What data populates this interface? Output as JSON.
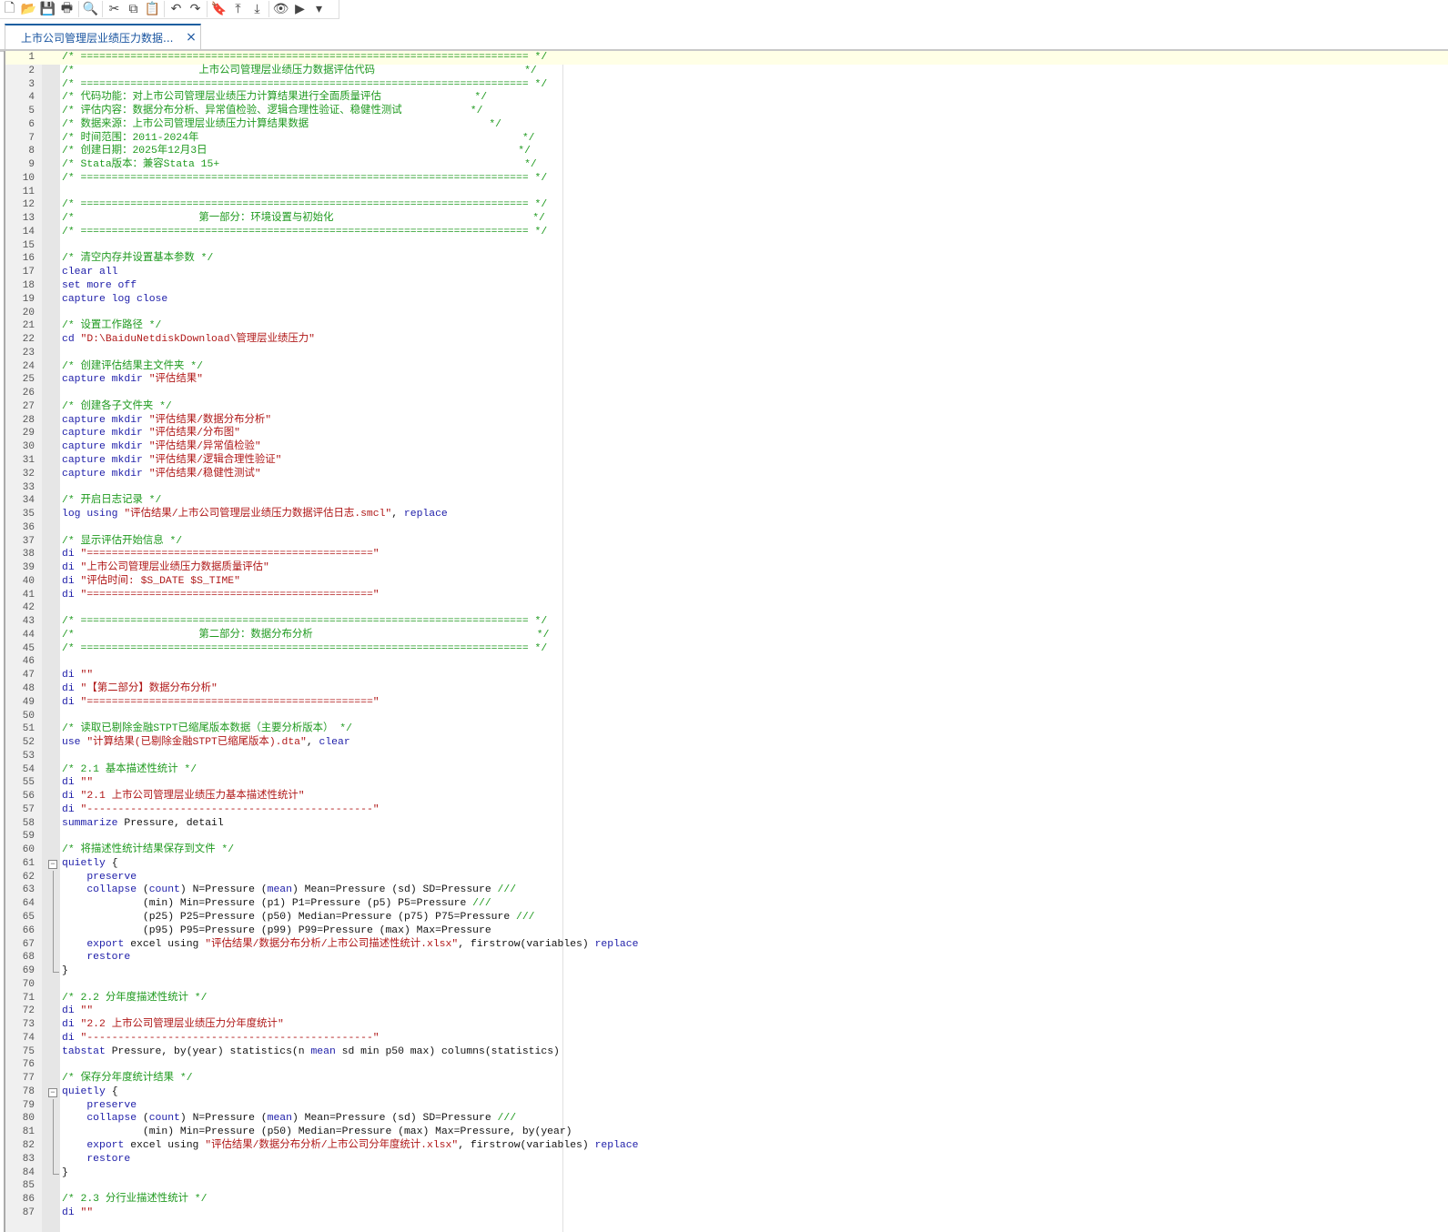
{
  "toolbar": {
    "items": [
      {
        "name": "new-file-icon",
        "glyph": "🗋"
      },
      {
        "name": "open-folder-icon",
        "glyph": "📂"
      },
      {
        "name": "save-icon",
        "glyph": "💾"
      },
      {
        "name": "print-icon",
        "glyph": "🖶"
      },
      {
        "sep": true
      },
      {
        "name": "find-icon",
        "glyph": "🔍"
      },
      {
        "sep": true
      },
      {
        "name": "cut-icon",
        "glyph": "✂"
      },
      {
        "name": "copy-icon",
        "glyph": "⧉"
      },
      {
        "name": "paste-icon",
        "glyph": "📋"
      },
      {
        "sep": true
      },
      {
        "name": "undo-icon",
        "glyph": "↶"
      },
      {
        "name": "redo-icon",
        "glyph": "↷"
      },
      {
        "sep": true
      },
      {
        "name": "toggle-bookmark-icon",
        "glyph": "🔖"
      },
      {
        "name": "previous-bookmark-icon",
        "glyph": "⤒"
      },
      {
        "name": "next-bookmark-icon",
        "glyph": "⤓"
      },
      {
        "sep": true
      },
      {
        "name": "show-file-icon",
        "glyph": "👁"
      },
      {
        "name": "execute-icon",
        "glyph": "▶"
      },
      {
        "name": "execute-dropdown-icon",
        "glyph": "▾"
      }
    ]
  },
  "tab": {
    "label": "上市公司管理层业绩压力数据...",
    "close": "×"
  },
  "colors": {
    "comment": "#1f9a1f",
    "keyword": "#1c1ca8",
    "string": "#b01818",
    "plain": "#111111"
  },
  "code": {
    "lines": [
      [
        [
          "c",
          "/* ======================================================================== */"
        ]
      ],
      [
        [
          "c",
          "/*                    上市公司管理层业绩压力数据评估代码                        */"
        ]
      ],
      [
        [
          "c",
          "/* ======================================================================== */"
        ]
      ],
      [
        [
          "c",
          "/* 代码功能：对上市公司管理层业绩压力计算结果进行全面质量评估               */"
        ]
      ],
      [
        [
          "c",
          "/* 评估内容：数据分布分析、异常值检验、逻辑合理性验证、稳健性测试           */"
        ]
      ],
      [
        [
          "c",
          "/* 数据来源：上市公司管理层业绩压力计算结果数据                             */"
        ]
      ],
      [
        [
          "c",
          "/* 时间范围：2011-2024年                                                    */"
        ]
      ],
      [
        [
          "c",
          "/* 创建日期：2025年12月3日                                                  */"
        ]
      ],
      [
        [
          "c",
          "/* Stata版本：兼容Stata 15+                                                 */"
        ]
      ],
      [
        [
          "c",
          "/* ======================================================================== */"
        ]
      ],
      [],
      [
        [
          "c",
          "/* ======================================================================== */"
        ]
      ],
      [
        [
          "c",
          "/*                    第一部分：环境设置与初始化                                */"
        ]
      ],
      [
        [
          "c",
          "/* ======================================================================== */"
        ]
      ],
      [],
      [
        [
          "c",
          "/* 清空内存并设置基本参数 */"
        ]
      ],
      [
        [
          "k",
          "clear all"
        ]
      ],
      [
        [
          "k",
          "set more off"
        ]
      ],
      [
        [
          "k",
          "capture log close"
        ]
      ],
      [],
      [
        [
          "c",
          "/* 设置工作路径 */"
        ]
      ],
      [
        [
          "k",
          "cd "
        ],
        [
          "s",
          "\"D:\\BaiduNetdiskDownload\\管理层业绩压力\""
        ]
      ],
      [],
      [
        [
          "c",
          "/* 创建评估结果主文件夹 */"
        ]
      ],
      [
        [
          "k",
          "capture mkdir "
        ],
        [
          "s",
          "\"评估结果\""
        ]
      ],
      [],
      [
        [
          "c",
          "/* 创建各子文件夹 */"
        ]
      ],
      [
        [
          "k",
          "capture mkdir "
        ],
        [
          "s",
          "\"评估结果/数据分布分析\""
        ]
      ],
      [
        [
          "k",
          "capture mkdir "
        ],
        [
          "s",
          "\"评估结果/分布图\""
        ]
      ],
      [
        [
          "k",
          "capture mkdir "
        ],
        [
          "s",
          "\"评估结果/异常值检验\""
        ]
      ],
      [
        [
          "k",
          "capture mkdir "
        ],
        [
          "s",
          "\"评估结果/逻辑合理性验证\""
        ]
      ],
      [
        [
          "k",
          "capture mkdir "
        ],
        [
          "s",
          "\"评估结果/稳健性测试\""
        ]
      ],
      [],
      [
        [
          "c",
          "/* 开启日志记录 */"
        ]
      ],
      [
        [
          "k",
          "log using "
        ],
        [
          "s",
          "\"评估结果/上市公司管理层业绩压力数据评估日志.smcl\""
        ],
        [
          "p",
          ", "
        ],
        [
          "k",
          "replace"
        ]
      ],
      [],
      [
        [
          "c",
          "/* 显示评估开始信息 */"
        ]
      ],
      [
        [
          "k",
          "di "
        ],
        [
          "s",
          "\"==============================================\""
        ]
      ],
      [
        [
          "k",
          "di "
        ],
        [
          "s",
          "\"上市公司管理层业绩压力数据质量评估\""
        ]
      ],
      [
        [
          "k",
          "di "
        ],
        [
          "s",
          "\"评估时间: $S_DATE $S_TIME\""
        ]
      ],
      [
        [
          "k",
          "di "
        ],
        [
          "s",
          "\"==============================================\""
        ]
      ],
      [],
      [
        [
          "c",
          "/* ======================================================================== */"
        ]
      ],
      [
        [
          "c",
          "/*                    第二部分：数据分布分析                                    */"
        ]
      ],
      [
        [
          "c",
          "/* ======================================================================== */"
        ]
      ],
      [],
      [
        [
          "k",
          "di "
        ],
        [
          "s",
          "\"\""
        ]
      ],
      [
        [
          "k",
          "di "
        ],
        [
          "s",
          "\"【第二部分】数据分布分析\""
        ]
      ],
      [
        [
          "k",
          "di "
        ],
        [
          "s",
          "\"==============================================\""
        ]
      ],
      [],
      [
        [
          "c",
          "/* 读取已剔除金融STPT已缩尾版本数据（主要分析版本） */"
        ]
      ],
      [
        [
          "k",
          "use "
        ],
        [
          "s",
          "\"计算结果(已剔除金融STPT已缩尾版本).dta\""
        ],
        [
          "p",
          ", "
        ],
        [
          "k",
          "clear"
        ]
      ],
      [],
      [
        [
          "c",
          "/* 2.1 基本描述性统计 */"
        ]
      ],
      [
        [
          "k",
          "di "
        ],
        [
          "s",
          "\"\""
        ]
      ],
      [
        [
          "k",
          "di "
        ],
        [
          "s",
          "\"2.1 上市公司管理层业绩压力基本描述性统计\""
        ]
      ],
      [
        [
          "k",
          "di "
        ],
        [
          "s",
          "\"----------------------------------------------\""
        ]
      ],
      [
        [
          "k",
          "summarize "
        ],
        [
          "p",
          "Pressure, detail"
        ]
      ],
      [],
      [
        [
          "c",
          "/* 将描述性统计结果保存到文件 */"
        ]
      ],
      [
        [
          "k",
          "quietly "
        ],
        [
          "p",
          "{"
        ]
      ],
      [
        [
          "p",
          "    "
        ],
        [
          "k",
          "preserve"
        ]
      ],
      [
        [
          "p",
          "    "
        ],
        [
          "k",
          "collapse "
        ],
        [
          "p",
          "("
        ],
        [
          "k",
          "count"
        ],
        [
          "p",
          ") N=Pressure ("
        ],
        [
          "k",
          "mean"
        ],
        [
          "p",
          ") Mean=Pressure (sd) SD=Pressure "
        ],
        [
          "c",
          "///"
        ]
      ],
      [
        [
          "p",
          "             (min) Min=Pressure (p1) P1=Pressure (p5) P5=Pressure "
        ],
        [
          "c",
          "///"
        ]
      ],
      [
        [
          "p",
          "             (p25) P25=Pressure (p50) Median=Pressure (p75) P75=Pressure "
        ],
        [
          "c",
          "///"
        ]
      ],
      [
        [
          "p",
          "             (p95) P95=Pressure (p99) P99=Pressure (max) Max=Pressure"
        ]
      ],
      [
        [
          "p",
          "    "
        ],
        [
          "k",
          "export "
        ],
        [
          "p",
          "excel using "
        ],
        [
          "s",
          "\"评估结果/数据分布分析/上市公司描述性统计.xlsx\""
        ],
        [
          "p",
          ", firstrow(variables) "
        ],
        [
          "k",
          "replace"
        ]
      ],
      [
        [
          "p",
          "    "
        ],
        [
          "k",
          "restore"
        ]
      ],
      [
        [
          "p",
          "}"
        ]
      ],
      [],
      [
        [
          "c",
          "/* 2.2 分年度描述性统计 */"
        ]
      ],
      [
        [
          "k",
          "di "
        ],
        [
          "s",
          "\"\""
        ]
      ],
      [
        [
          "k",
          "di "
        ],
        [
          "s",
          "\"2.2 上市公司管理层业绩压力分年度统计\""
        ]
      ],
      [
        [
          "k",
          "di "
        ],
        [
          "s",
          "\"----------------------------------------------\""
        ]
      ],
      [
        [
          "k",
          "tabstat "
        ],
        [
          "p",
          "Pressure, by(year) statistics(n "
        ],
        [
          "k",
          "mean"
        ],
        [
          "p",
          " sd min p50 max) columns(statistics)"
        ]
      ],
      [],
      [
        [
          "c",
          "/* 保存分年度统计结果 */"
        ]
      ],
      [
        [
          "k",
          "quietly "
        ],
        [
          "p",
          "{"
        ]
      ],
      [
        [
          "p",
          "    "
        ],
        [
          "k",
          "preserve"
        ]
      ],
      [
        [
          "p",
          "    "
        ],
        [
          "k",
          "collapse "
        ],
        [
          "p",
          "("
        ],
        [
          "k",
          "count"
        ],
        [
          "p",
          ") N=Pressure ("
        ],
        [
          "k",
          "mean"
        ],
        [
          "p",
          ") Mean=Pressure (sd) SD=Pressure "
        ],
        [
          "c",
          "///"
        ]
      ],
      [
        [
          "p",
          "             (min) Min=Pressure (p50) Median=Pressure (max) Max=Pressure, by(year)"
        ]
      ],
      [
        [
          "p",
          "    "
        ],
        [
          "k",
          "export "
        ],
        [
          "p",
          "excel using "
        ],
        [
          "s",
          "\"评估结果/数据分布分析/上市公司分年度统计.xlsx\""
        ],
        [
          "p",
          ", firstrow(variables) "
        ],
        [
          "k",
          "replace"
        ]
      ],
      [
        [
          "p",
          "    "
        ],
        [
          "k",
          "restore"
        ]
      ],
      [
        [
          "p",
          "}"
        ]
      ],
      [],
      [
        [
          "c",
          "/* 2.3 分行业描述性统计 */"
        ]
      ],
      [
        [
          "k",
          "di "
        ],
        [
          "s",
          "\"\""
        ]
      ]
    ],
    "current_line": 1,
    "fold_blocks": [
      [
        61,
        69
      ],
      [
        78,
        84
      ]
    ]
  }
}
